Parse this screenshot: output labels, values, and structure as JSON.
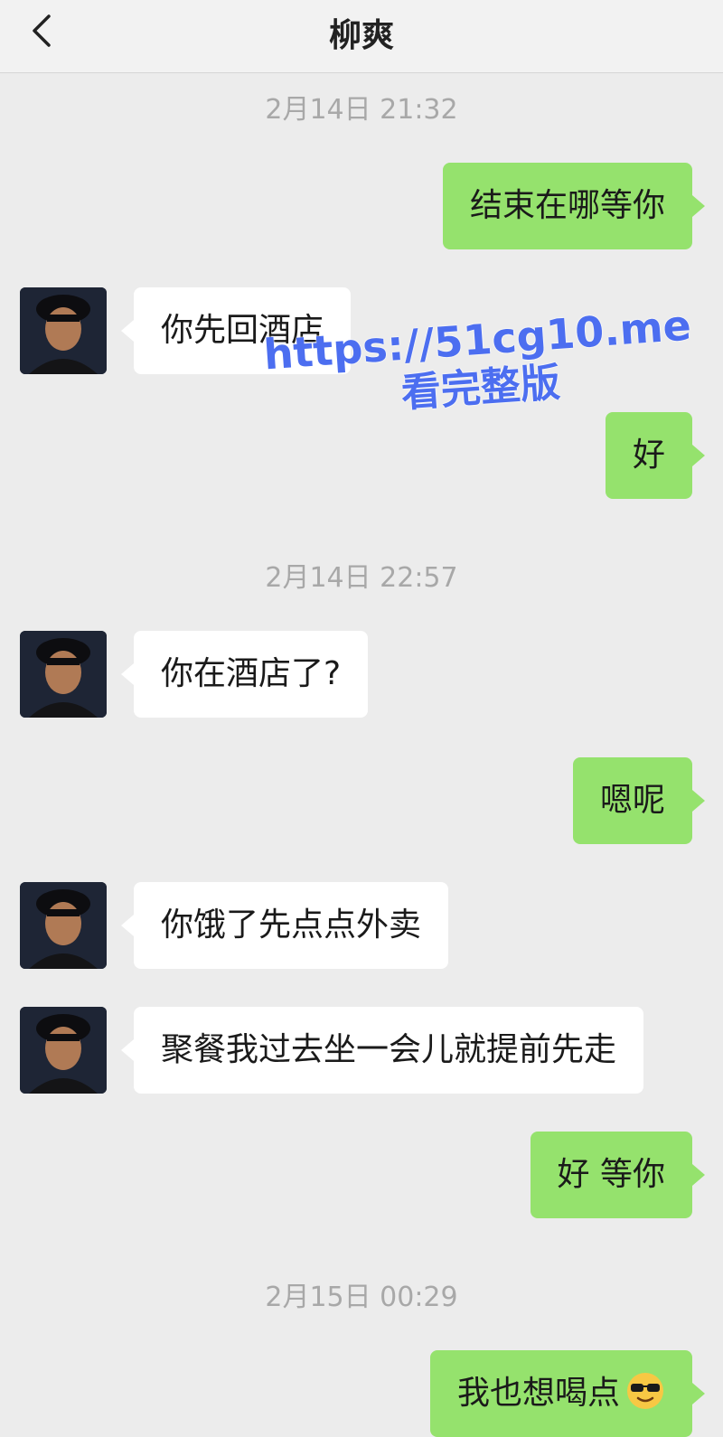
{
  "header": {
    "back_icon": "chevron-left-icon",
    "title": "柳爽"
  },
  "messages": [
    {
      "type": "timestamp",
      "text": "2月14日 21:32"
    },
    {
      "type": "out",
      "text": "结束在哪等你"
    },
    {
      "type": "in",
      "text": "你先回酒店"
    },
    {
      "type": "out",
      "text": "好"
    },
    {
      "type": "timestamp",
      "text": "2月14日 22:57"
    },
    {
      "type": "in",
      "text": "你在酒店了?"
    },
    {
      "type": "out",
      "text": "嗯呢"
    },
    {
      "type": "in",
      "text": "你饿了先点点外卖"
    },
    {
      "type": "in",
      "text": "聚餐我过去坐一会儿就提前先走"
    },
    {
      "type": "out",
      "text": "好 等你"
    },
    {
      "type": "timestamp",
      "text": "2月15日 00:29"
    },
    {
      "type": "out",
      "text": "我也想喝点",
      "emoji": "sunglasses-emoji-icon"
    }
  ],
  "watermark": {
    "line1": "https://51cg10.me",
    "line2": "看完整版"
  },
  "colors": {
    "outgoing": "#95e26d",
    "incoming": "#ffffff",
    "background": "#ececec"
  }
}
